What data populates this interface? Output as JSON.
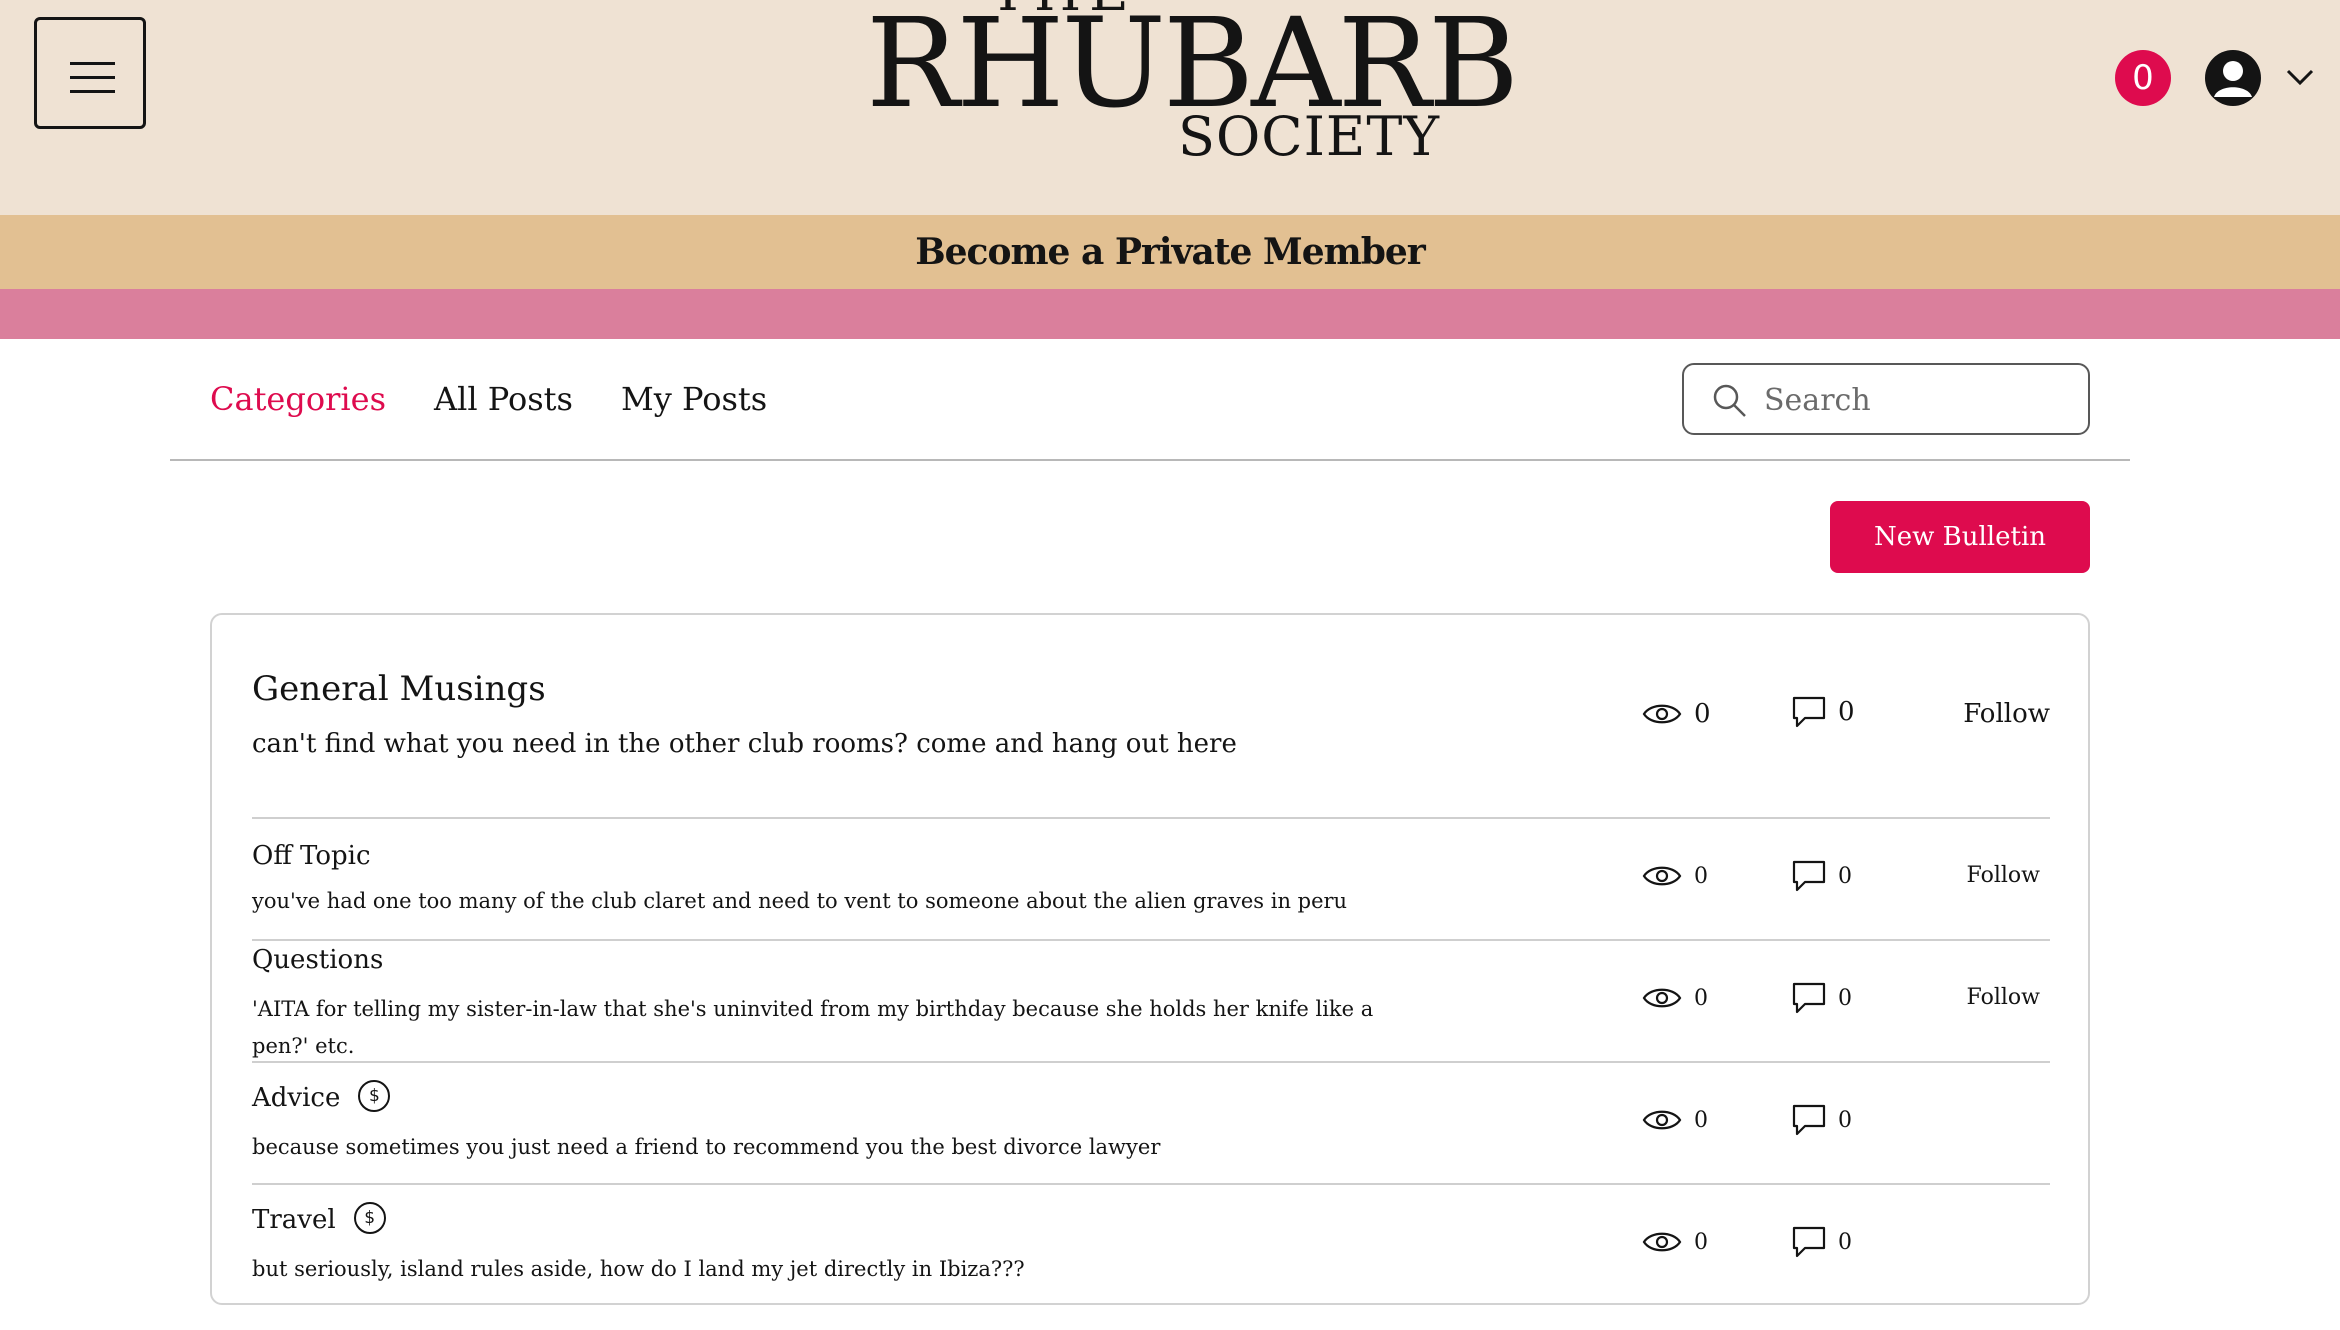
{
  "header": {
    "logo_top": "THE",
    "logo_main": "RHUBARB",
    "logo_sub": "SOCIETY",
    "cart_count": "0"
  },
  "banner": {
    "member_label": "Become a Private Member"
  },
  "nav": {
    "tabs": [
      {
        "label": "Categories",
        "active": true
      },
      {
        "label": "All Posts",
        "active": false
      },
      {
        "label": "My Posts",
        "active": false
      }
    ],
    "search_placeholder": "Search"
  },
  "actions": {
    "new_bulletin": "New Bulletin"
  },
  "categories": [
    {
      "title": "General Musings",
      "description": "can't find what you need in the other club rooms? come and hang out here",
      "views": "0",
      "comments": "0",
      "follow": "Follow"
    },
    {
      "title": "Off Topic",
      "description": "you've had one too many of the club claret and need to vent to someone about the alien graves in peru",
      "views": "0",
      "comments": "0",
      "follow": "Follow"
    },
    {
      "title": "Questions",
      "description": "'AITA for telling my sister-in-law that she's uninvited from my birthday because she holds her knife like a pen?' etc.",
      "views": "0",
      "comments": "0",
      "follow": "Follow"
    },
    {
      "title": "Advice",
      "paid_symbol": "$",
      "description": "because sometimes you just need a friend to recommend you the best divorce lawyer",
      "views": "0",
      "comments": "0"
    },
    {
      "title": "Travel",
      "paid_symbol": "$",
      "description": "but seriously, island rules aside, how do I land my jet directly in Ibiza???",
      "views": "0",
      "comments": "0"
    }
  ],
  "colors": {
    "header_bg": "#efe2d3",
    "member_bar": "#e2c092",
    "pink_bar": "#da7f9c",
    "accent": "#de0b4e"
  },
  "icons": [
    "menu-icon",
    "cart-badge",
    "avatar-icon",
    "chevron-down-icon",
    "search-icon",
    "eye-icon",
    "comment-icon",
    "paid-icon"
  ]
}
